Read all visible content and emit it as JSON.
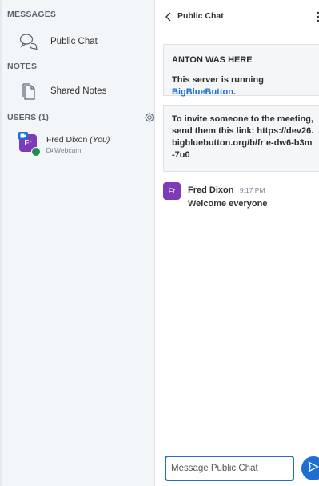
{
  "sidebar": {
    "messages_title": "MESSAGES",
    "public_chat_label": "Public Chat",
    "notes_title": "NOTES",
    "shared_notes_label": "Shared Notes",
    "users_title": "USERS (1)",
    "users": [
      {
        "initials": "Fr",
        "name": "Fred Dixon",
        "you_tag": "(You)",
        "status": "Webcam"
      }
    ]
  },
  "chat": {
    "title": "Public Chat",
    "system_messages": [
      {
        "line1": "ANTON WAS HERE",
        "line2_prefix": "This server is running ",
        "line2_link": "BigBlueButton",
        "line2_suffix": "."
      },
      {
        "text": "To invite someone to the meeting, send them this link: https://dev26.bigbluebutton.org/b/fr e-dw6-b3m-7u0"
      }
    ],
    "messages": [
      {
        "initials": "Fr",
        "author": "Fred Dixon",
        "time": "9:17 PM",
        "text": "Welcome everyone"
      }
    ],
    "composer_placeholder": "Message Public Chat"
  },
  "colors": {
    "accent": "#1f6fd1",
    "avatar": "#7d3bb8",
    "mic_badge": "#1b8e4c",
    "sidebar_bg": "#f3f6f9"
  }
}
